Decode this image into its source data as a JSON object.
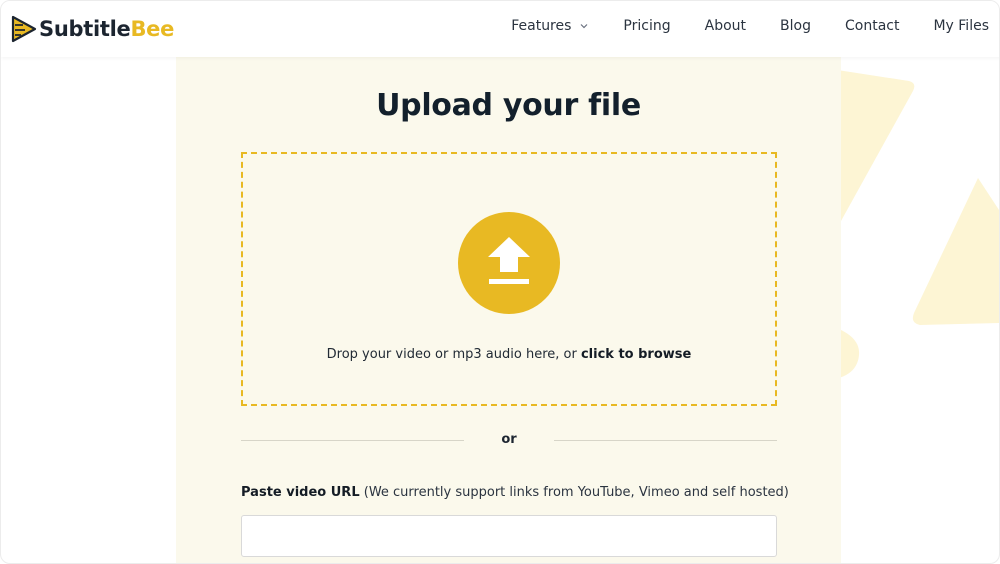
{
  "brand": {
    "name_part1": "Subtitle",
    "name_part2": "Bee",
    "accent_color": "#e8b923"
  },
  "nav": {
    "items": [
      {
        "label": "Features",
        "has_dropdown": true
      },
      {
        "label": "Pricing"
      },
      {
        "label": "About"
      },
      {
        "label": "Blog"
      },
      {
        "label": "Contact"
      },
      {
        "label": "My Files"
      }
    ]
  },
  "upload": {
    "title": "Upload your file",
    "icon": "upload-arrow-icon",
    "drop_text": "Drop your video or mp3 audio here, or ",
    "browse_text": "click to browse",
    "or_text": "or"
  },
  "url": {
    "label_bold": "Paste video URL",
    "label_rest": " (We currently support links from YouTube, Vimeo and self hosted)",
    "value": "",
    "placeholder": ""
  }
}
